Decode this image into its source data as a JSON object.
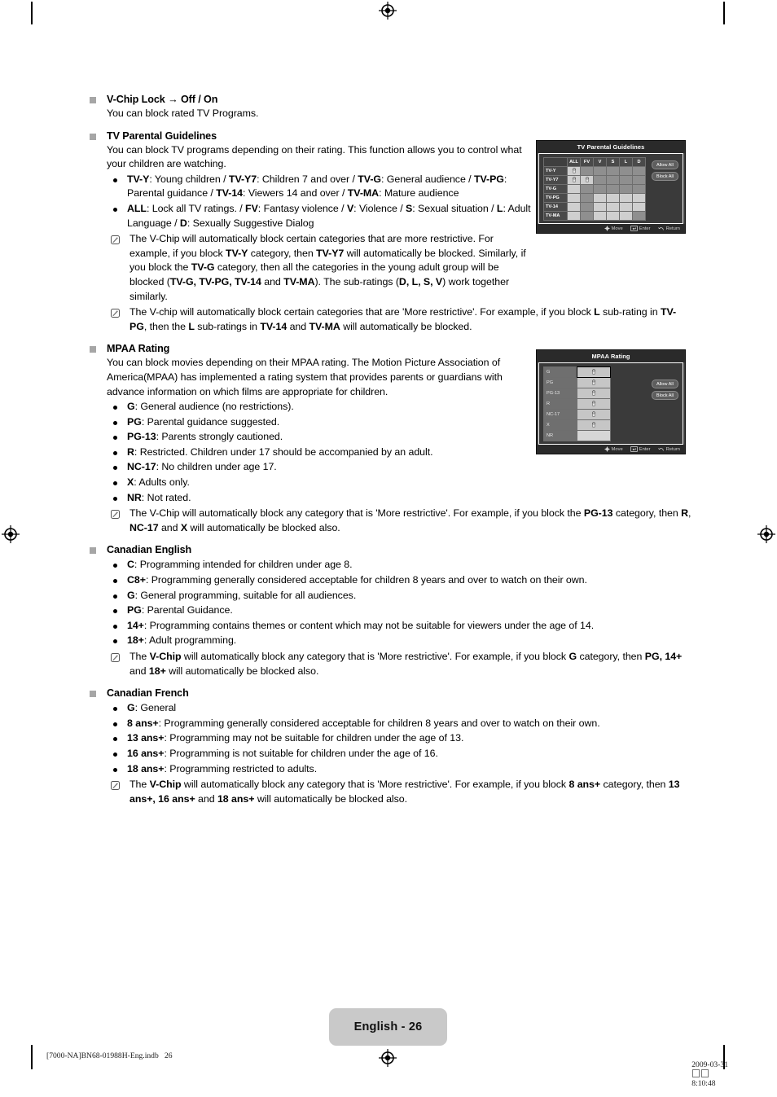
{
  "page": {
    "badge": "English - 26",
    "footer_left": "[7000-NA]BN68-01988H-Eng.indb   26",
    "footer_right_date": "2009-03-31",
    "footer_right_time": "8:10:48"
  },
  "sections": [
    {
      "id": "vchip-lock",
      "title": "V-Chip Lock → Off / On",
      "paragraph": "You can block rated TV Programs."
    },
    {
      "id": "tv-parental-guidelines",
      "title": "TV Parental Guidelines",
      "paragraph": "You can block TV programs depending on their rating. This function allows you to control what your children are watching.",
      "bullets": [
        "<b>TV-Y</b>: Young children / <b>TV-Y7</b>: Children 7 and over / <b>TV-G</b>: General audience / <b>TV-PG</b>: Parental guidance / <b>TV-14</b>: Viewers 14 and over / <b>TV-MA</b>: Mature audience",
        "<b>ALL</b>: Lock all TV ratings. / <b>FV</b>: Fantasy violence / <b>V</b>: Violence / <b>S</b>: Sexual situation / <b>L</b>: Adult Language / <b>D</b>: Sexually Suggestive Dialog"
      ],
      "notes": [
        "The V-Chip will automatically block certain categories that are more restrictive. For example, if you block <b>TV-Y</b> category, then <b>TV-Y7</b> will automatically be blocked. Similarly, if you block the <b>TV-G</b> category, then all the categories in the young adult group will be blocked (<b>TV-G, TV-PG, TV-14</b> and <b>TV-MA</b>). The sub-ratings (<b>D, L, S, V</b>) work together similarly.",
        "The V-chip will automatically block certain categories that are 'More restrictive'. For example, if you block <b>L</b> sub-rating in <b>TV-PG</b>, then the <b>L</b> sub-ratings in <b>TV-14</b> and <b>TV-MA</b> will automatically be blocked."
      ]
    },
    {
      "id": "mpaa-rating",
      "title": "MPAA Rating",
      "paragraph": "You can block movies depending on their MPAA rating. The Motion Picture Association of America(MPAA) has implemented a rating system that provides parents or guardians with advance information on which films are appropriate for children.",
      "bullets": [
        "<b>G</b>: General audience (no restrictions).",
        "<b>PG</b>: Parental guidance suggested.",
        "<b>PG-13</b>: Parents strongly cautioned.",
        "<b>R</b>: Restricted. Children under 17 should be accompanied by an adult.",
        "<b>NC-17</b>: No children under age 17.",
        "<b>X</b>: Adults only.",
        "<b>NR</b>: Not rated."
      ],
      "notes": [
        "The V-Chip will automatically block any category that is 'More restrictive'. For example, if you block the <b>PG-13</b> category, then <b>R</b>, <b>NC-17</b> and <b>X</b> will automatically be blocked also."
      ]
    },
    {
      "id": "canadian-english",
      "title": "Canadian English",
      "bullets": [
        "<b>C</b>: Programming intended for children under age 8.",
        "<b>C8+</b>: Programming generally considered acceptable for children 8 years and over to watch on their own.",
        "<b>G</b>: General programming, suitable for all audiences.",
        "<b>PG</b>: Parental Guidance.",
        "<b>14+</b>: Programming contains themes or content which may not be suitable for viewers under the age of 14.",
        "<b>18+</b>: Adult programming."
      ],
      "notes": [
        "The <b>V-Chip</b> will automatically block any category that is 'More restrictive'. For example, if you block <b>G</b> category, then <b>PG, 14+</b> and <b>18+</b> will automatically be blocked also."
      ]
    },
    {
      "id": "canadian-french",
      "title": "Canadian French",
      "bullets": [
        "<b>G</b>: General",
        "<b>8 ans+</b>: Programming generally considered acceptable for children 8 years and over to watch on their own.",
        "<b>13 ans+</b>: Programming may not be suitable for children under the age of 13.",
        "<b>16 ans+</b>: Programming is not suitable for children under the age of 16.",
        "<b>18 ans+</b>: Programming restricted to adults."
      ],
      "notes": [
        "The <b>V-Chip</b> will automatically block any category that is 'More restrictive'. For example, if you block <b>8 ans+</b> category, then <b>13 ans+, 16 ans+</b> and <b>18 ans+</b> will automatically be blocked also."
      ]
    }
  ],
  "osd_tvpg": {
    "title": "TV Parental Guidelines",
    "columns": [
      "",
      "ALL",
      "FV",
      "V",
      "S",
      "L",
      "D"
    ],
    "rows": [
      {
        "label": "TV-Y",
        "cells": [
          "lock",
          "dark",
          "dark",
          "dark",
          "dark",
          "dark"
        ]
      },
      {
        "label": "TV-Y7",
        "cells": [
          "lock",
          "lock",
          "dark",
          "dark",
          "dark",
          "dark"
        ]
      },
      {
        "label": "TV-G",
        "cells": [
          "light",
          "dark",
          "dark",
          "dark",
          "dark",
          "dark"
        ]
      },
      {
        "label": "TV-PG",
        "cells": [
          "light",
          "dark",
          "light",
          "light",
          "light",
          "light"
        ]
      },
      {
        "label": "TV-14",
        "cells": [
          "light",
          "dark",
          "light",
          "light",
          "light",
          "light"
        ]
      },
      {
        "label": "TV-MA",
        "cells": [
          "light",
          "dark",
          "light",
          "light",
          "light",
          "dark"
        ]
      }
    ],
    "buttons": [
      "Allow All",
      "Block All"
    ],
    "hints": [
      "Move",
      "Enter",
      "Return"
    ]
  },
  "osd_mpaa": {
    "title": "MPAA Rating",
    "rows": [
      {
        "label": "G",
        "locked": true,
        "selected": true
      },
      {
        "label": "PG",
        "locked": true,
        "selected": false
      },
      {
        "label": "PG-13",
        "locked": true,
        "selected": false
      },
      {
        "label": "R",
        "locked": true,
        "selected": false
      },
      {
        "label": "NC-17",
        "locked": true,
        "selected": false
      },
      {
        "label": "X",
        "locked": true,
        "selected": false
      },
      {
        "label": "NR",
        "locked": false,
        "selected": false
      }
    ],
    "buttons": [
      "Allow All",
      "Block All"
    ],
    "hints": [
      "Move",
      "Enter",
      "Return"
    ]
  }
}
